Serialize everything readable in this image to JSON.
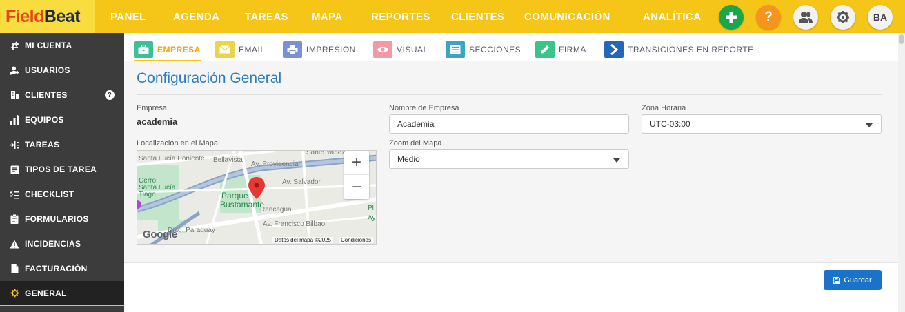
{
  "brand": {
    "part1": "Field",
    "part2": "Beat"
  },
  "topnav": [
    {
      "label": "PANEL"
    },
    {
      "label": "AGENDA"
    },
    {
      "label": "TAREAS"
    },
    {
      "label": "MAPA"
    },
    {
      "label": "REPORTES"
    },
    {
      "label": "CLIENTES"
    },
    {
      "label": "COMUNICACIÓN"
    },
    {
      "label": "ANALÍTICA"
    }
  ],
  "topactions": {
    "add_icon": "plus-icon",
    "help_label": "?",
    "users_icon": "user-group-icon",
    "settings_icon": "gear-icon",
    "avatar_initials": "BA",
    "add_color": "#1aa64a",
    "help_color": "#f7941d"
  },
  "sidebar": {
    "items": [
      {
        "label": "MI CUENTA",
        "icon": "swap-arrows-icon"
      },
      {
        "label": "USUARIOS",
        "icon": "user-add-icon"
      },
      {
        "label": "CLIENTES",
        "icon": "building-icon",
        "help": "?"
      },
      {
        "label": "EQUIPOS",
        "icon": "team-chart-icon"
      },
      {
        "label": "TAREAS",
        "icon": "task-list-icon"
      },
      {
        "label": "TIPOS DE TAREA",
        "icon": "task-type-icon"
      },
      {
        "label": "CHECKLIST",
        "icon": "checklist-icon"
      },
      {
        "label": "FORMULARIOS",
        "icon": "clipboard-icon"
      },
      {
        "label": "INCIDENCIAS",
        "icon": "warning-icon"
      },
      {
        "label": "FACTURACIÓN",
        "icon": "document-icon"
      },
      {
        "label": "GENERAL",
        "icon": "gear-icon",
        "active": true
      }
    ]
  },
  "tabs": [
    {
      "label": "EMPRESA",
      "color": "#3dbf9a",
      "active": true
    },
    {
      "label": "EMAIL",
      "color": "#e9d44a"
    },
    {
      "label": "IMPRESIÓN",
      "color": "#7b8fd6"
    },
    {
      "label": "VISUAL",
      "color": "#f19aa6"
    },
    {
      "label": "SECCIONES",
      "color": "#3da5c4"
    },
    {
      "label": "FIRMA",
      "color": "#3ac48a"
    },
    {
      "label": "TRANSICIONES EN REPORTE",
      "color": "#2466b8"
    }
  ],
  "page": {
    "title": "Configuración General",
    "empresa_label": "Empresa",
    "empresa_value": "academia",
    "nombre_label": "Nombre de Empresa",
    "nombre_value": "Academia",
    "zona_label": "Zona Horaria",
    "zona_value": "UTC-03:00",
    "ubicacion_label": "Localizacion en el Mapa",
    "zoom_label": "Zoom del Mapa",
    "zoom_value": "Medio"
  },
  "map": {
    "zoom_in": "+",
    "zoom_out": "−",
    "labels": [
      "Bellavista",
      "Santa Lucía Poniente",
      "Av. Providencia",
      "Av. Salvador",
      "Parque",
      "Bustamante",
      "Rancagua",
      "Av. Francisco Bilbao",
      "Diag. Paraguay",
      "Cerro",
      "Santa Lucía",
      "Tiago",
      "Pl",
      "Ay",
      "Santo Yanez"
    ],
    "google_logo": "Google",
    "attribution": "Datos del mapa ©2025",
    "terms": "Condiciones"
  },
  "footer": {
    "save_label": "Guardar",
    "save_icon": "floppy-disk-icon"
  }
}
